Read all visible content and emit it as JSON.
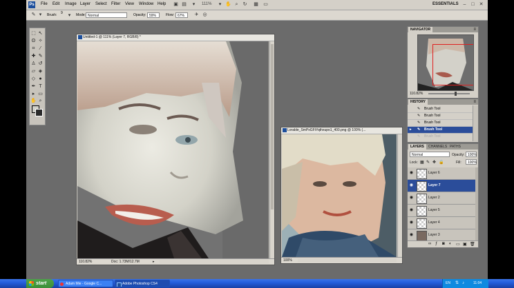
{
  "menu": {
    "items": [
      "File",
      "Edit",
      "Image",
      "Layer",
      "Select",
      "Filter",
      "View",
      "Window",
      "Help"
    ],
    "zoom_label": "111%",
    "workspace": "ESSENTIALS"
  },
  "options": {
    "brush_label": "Brush:",
    "brush_size": "9",
    "mode_label": "Mode:",
    "mode_value": "Normal",
    "opacity_label": "Opacity:",
    "opacity_value": "59%",
    "flow_label": "Flow:",
    "flow_value": "67%"
  },
  "doc_main": {
    "title": "Untitled-1 @ 111% (Layer 7, RGB/8) *",
    "zoom": "110.82%",
    "doc_size": "Doc: 1.73M/12.7M"
  },
  "doc_ref": {
    "title": "Lorable_SmPxGFtYqthxupo1_400.png @ 100% (...",
    "zoom": "100%"
  },
  "navigator": {
    "tab": "NAVIGATOR",
    "zoom": "110.82%"
  },
  "history": {
    "tab": "HISTORY",
    "rows": [
      "Brush Tool",
      "Brush Tool",
      "Brush Tool",
      "Brush Tool"
    ],
    "faded_row": "Brush Tool"
  },
  "layers": {
    "tabs": [
      "LAYERS",
      "CHANNELS",
      "PATHS"
    ],
    "blend_mode": "Normal",
    "opacity_label": "Opacity:",
    "opacity_value": "100%",
    "lock_label": "Lock:",
    "fill_label": "Fill:",
    "fill_value": "100%",
    "rows": [
      "Layer 6",
      "Layer 7",
      "Layer 2",
      "Layer 5",
      "Layer 4",
      "Layer 3"
    ]
  },
  "taskbar": {
    "start": "start",
    "tasks": [
      "Adam Mie - Google C...",
      "Adobe Photoshop CS4"
    ],
    "lang": "EN",
    "clock": "11:04"
  },
  "colors": {
    "accent": "#2b4d9a",
    "app_bg": "#6b6b6b",
    "taskbar": "#245edc"
  }
}
